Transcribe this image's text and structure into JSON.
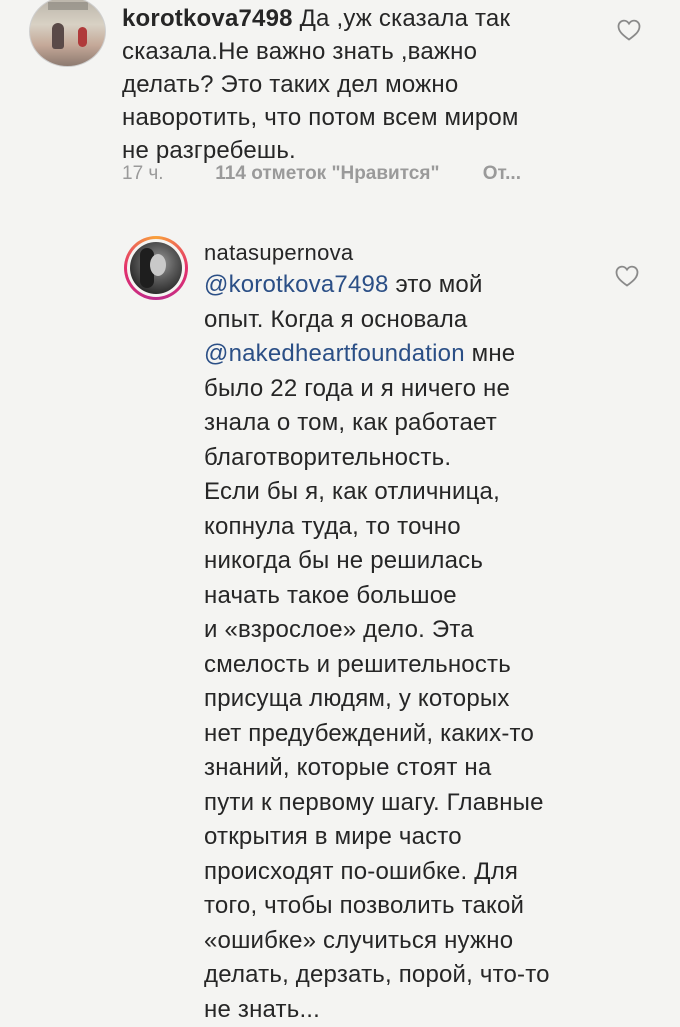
{
  "comment1": {
    "username": "korotkova7498",
    "text_lines": [
      "Да ,уж сказала так",
      "сказала.Не важно знать ,важно",
      "делать? Это  таких дел можно",
      "наворотить, что потом всем миром",
      "не разгребешь."
    ],
    "time": "17 ч.",
    "likes": "114 отметок \"Нравится\"",
    "reply": "От..."
  },
  "comment2": {
    "username": "natasupernova",
    "mention1": "@korotkova7498",
    "line1_rest": " это мой",
    "line2": "опыт. Когда я основала",
    "mention2": "@nakedheartfoundation",
    "line3_rest": " мне",
    "lines_after": [
      "было 22 года и я ничего не",
      "знала о том, как работает",
      "благотворительность.",
      "Если бы я, как отличница,",
      "копнула туда, то точно",
      "никогда бы не решилась",
      "начать такое большое",
      "и «взрослое» дело. Эта",
      "смелость и решительность",
      "присуща людям, у которых",
      "нет предубеждений, каких-то",
      "знаний, которые стоят на",
      "пути к первому шагу. Главные",
      "открытия в мире часто",
      "происходят по-ошибке. Для",
      "того, чтобы позволить такой",
      "«ошибке» случиться нужно",
      "делать, дерзать, порой, что-то",
      "не знать..."
    ]
  },
  "icons": {
    "like1": "heart-outline-icon",
    "like2": "heart-outline-icon"
  },
  "colors": {
    "mention": "#2b4f86",
    "meta": "#9a9a9a"
  }
}
